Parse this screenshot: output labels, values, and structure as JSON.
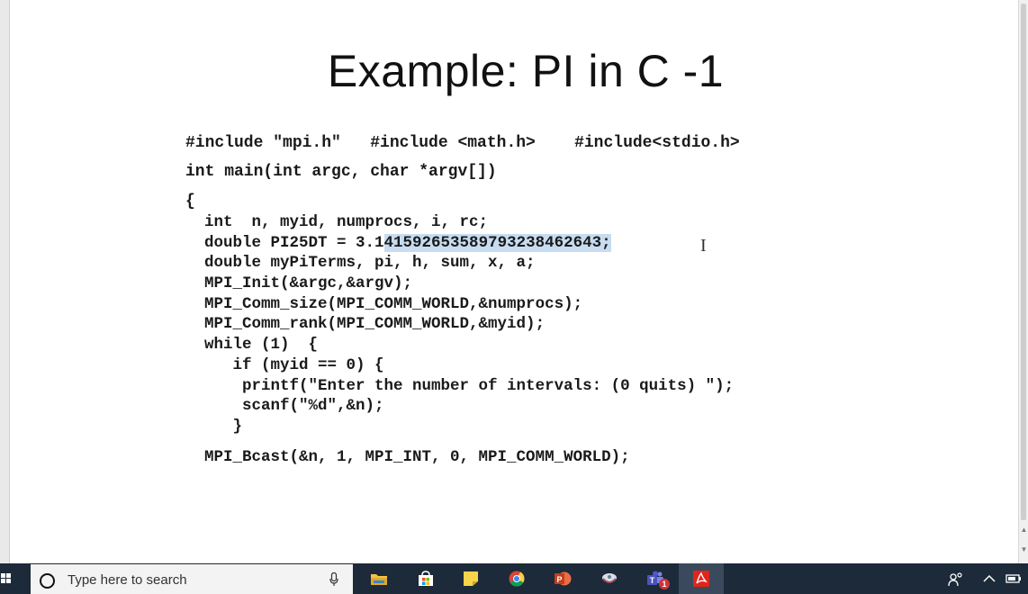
{
  "slide": {
    "title": "Example:  PI in C -1"
  },
  "code": {
    "line1": "#include \"mpi.h\"   #include <math.h>    #include<stdio.h>",
    "line2": "int main(int argc, char *argv[])",
    "line3": "{",
    "line4": "  int  n, myid, numprocs, i, rc;",
    "line5_pre": "  double PI25DT = 3.1",
    "line5_sel": "41592653589793238462643;",
    "line6": "  double myPiTerms, pi, h, sum, x, a;",
    "line7": "  MPI_Init(&argc,&argv);",
    "line8": "  MPI_Comm_size(MPI_COMM_WORLD,&numprocs);",
    "line9": "  MPI_Comm_rank(MPI_COMM_WORLD,&myid);",
    "line10": "  while (1)  {",
    "line11": "     if (myid == 0) {",
    "line12": "      printf(\"Enter the number of intervals: (0 quits) \");",
    "line13": "      scanf(\"%d\",&n);",
    "line14": "     }",
    "line15": "  MPI_Bcast(&n, 1, MPI_INT, 0, MPI_COMM_WORLD);"
  },
  "taskbar": {
    "search_placeholder": "Type here to search",
    "apps": [
      "file-explorer",
      "microsoft-store",
      "sticky-notes",
      "chrome",
      "powerpoint",
      "unknown-app",
      "teams",
      "acrobat"
    ],
    "teams_badge": "1",
    "accent": "#1c2a3a"
  }
}
